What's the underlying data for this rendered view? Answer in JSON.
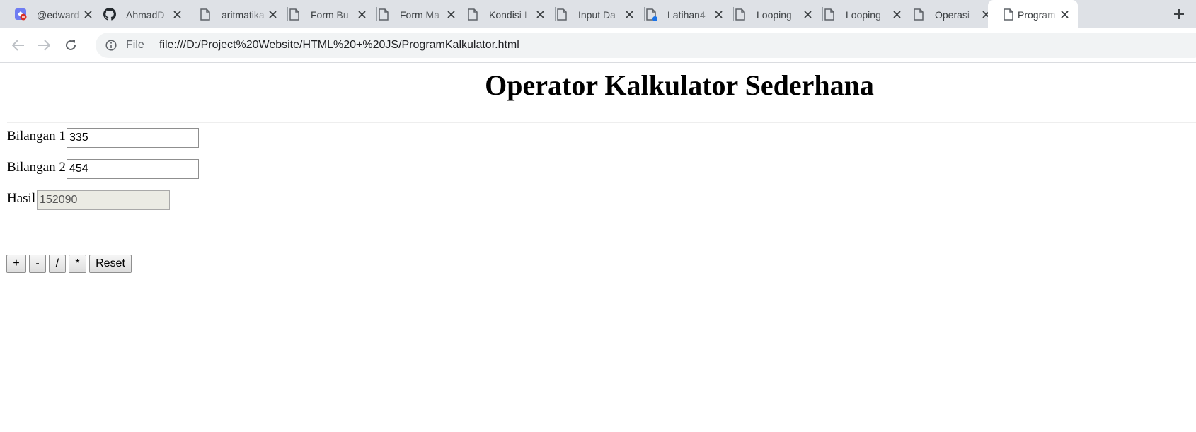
{
  "tabs": [
    {
      "title": "@edward",
      "icon": "app-icon-badge"
    },
    {
      "title": "AhmadD",
      "icon": "github-icon"
    },
    {
      "title": "aritmatika",
      "icon": "document-icon"
    },
    {
      "title": "Form Bu",
      "icon": "document-icon"
    },
    {
      "title": "Form Ma",
      "icon": "document-icon"
    },
    {
      "title": "Kondisi I",
      "icon": "document-icon"
    },
    {
      "title": "Input Da",
      "icon": "document-icon"
    },
    {
      "title": "Latihan4",
      "icon": "document-icon"
    },
    {
      "title": "Looping",
      "icon": "document-icon"
    },
    {
      "title": "Looping",
      "icon": "document-icon"
    },
    {
      "title": "Operasi",
      "icon": "document-icon"
    },
    {
      "title": "Program",
      "icon": "document-icon"
    }
  ],
  "active_tab_index": 11,
  "toolbar": {
    "scheme_label": "File",
    "url": "file:///D:/Project%20Website/HTML%20+%20JS/ProgramKalkulator.html"
  },
  "page": {
    "title": "Operator Kalkulator Sederhana",
    "bilangan1_label": "Bilangan 1",
    "bilangan1_value": "335",
    "bilangan2_label": "Bilangan 2",
    "bilangan2_value": "454",
    "hasil_label": "Hasil",
    "hasil_value": "152090",
    "buttons": {
      "add": "+",
      "subtract": "-",
      "divide": "/",
      "multiply": "*",
      "reset": "Reset"
    }
  },
  "colors": {
    "tabstrip_bg": "#dee1e6",
    "omnibox_bg": "#f1f3f4",
    "readonly_field_bg": "#ebebe4"
  }
}
